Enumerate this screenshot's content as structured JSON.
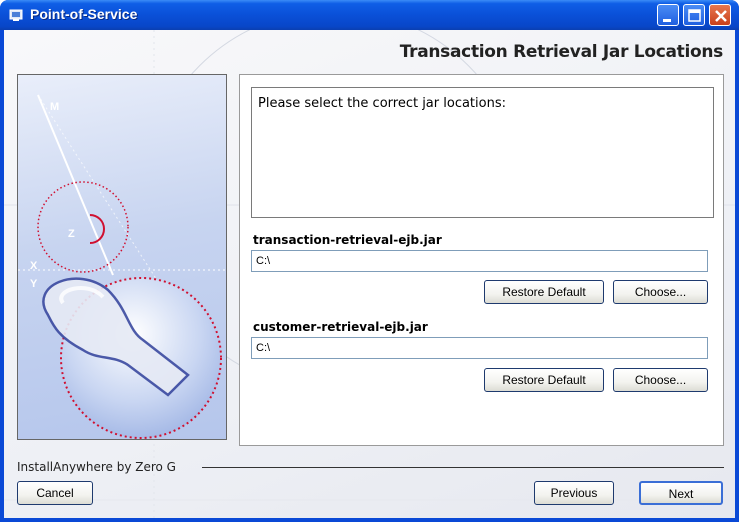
{
  "window": {
    "title": "Point-of-Service",
    "controls": [
      "minimize",
      "maximize",
      "close"
    ]
  },
  "header": {
    "title": "Transaction Retrieval Jar Locations"
  },
  "prompt": {
    "text": "Please select the correct jar locations:"
  },
  "fields": [
    {
      "label": "transaction-retrieval-ejb.jar",
      "value": "C:\\",
      "restore_label": "Restore Default",
      "choose_label": "Choose..."
    },
    {
      "label": "customer-retrieval-ejb.jar",
      "value": "C:\\",
      "restore_label": "Restore Default",
      "choose_label": "Choose..."
    }
  ],
  "footer": {
    "vendor": "InstallAnywhere by Zero G",
    "cancel_label": "Cancel",
    "previous_label": "Previous",
    "next_label": "Next"
  },
  "art": {
    "labels": [
      "M",
      "Z",
      "X",
      "Y"
    ]
  },
  "colors": {
    "titlebar": "#0a50d8",
    "accent_red": "#d01030",
    "art_blue": "#b5c6ec"
  }
}
